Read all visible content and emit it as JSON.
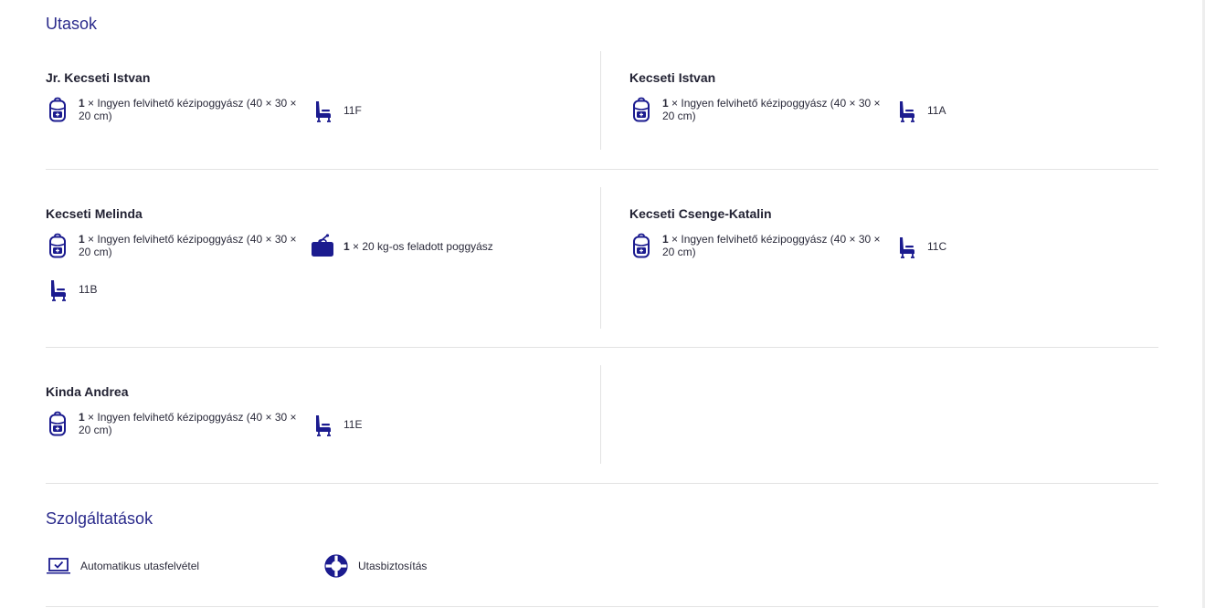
{
  "sections": {
    "passengers_title": "Utasok",
    "services_title": "Szolgáltatások"
  },
  "passengers": [
    {
      "name": "Jr. Kecseti Istvan",
      "bag_count": "1",
      "bag_text": " × Ingyen felvihető kézipoggyász (40 × 30 × 20 cm)",
      "seat": "11F"
    },
    {
      "name": "Kecseti Istvan",
      "bag_count": "1",
      "bag_text": " × Ingyen felvihető kézipoggyász (40 × 30 × 20 cm)",
      "seat": "11A"
    },
    {
      "name": "Kecseti Melinda",
      "bag_count": "1",
      "bag_text": " × Ingyen felvihető kézipoggyász (40 × 30 × 20 cm)",
      "checked_count": "1",
      "checked_text": " × 20 kg-os feladott poggyász",
      "seat": "11B"
    },
    {
      "name": "Kecseti Csenge-Katalin",
      "bag_count": "1",
      "bag_text": " × Ingyen felvihető kézipoggyász (40 × 30 × 20 cm)",
      "seat": "11C"
    },
    {
      "name": "Kinda Andrea",
      "bag_count": "1",
      "bag_text": " × Ingyen felvihető kézipoggyász (40 × 30 × 20 cm)",
      "seat": "11E"
    }
  ],
  "services": [
    {
      "label": "Automatikus utasfelvétel",
      "icon": "laptop-check-icon"
    },
    {
      "label": "Utasbiztosítás",
      "icon": "lifebuoy-icon"
    }
  ],
  "colors": {
    "accent": "#1b1b8f",
    "divider": "#e3e3e3",
    "title": "#2b2b8c"
  }
}
